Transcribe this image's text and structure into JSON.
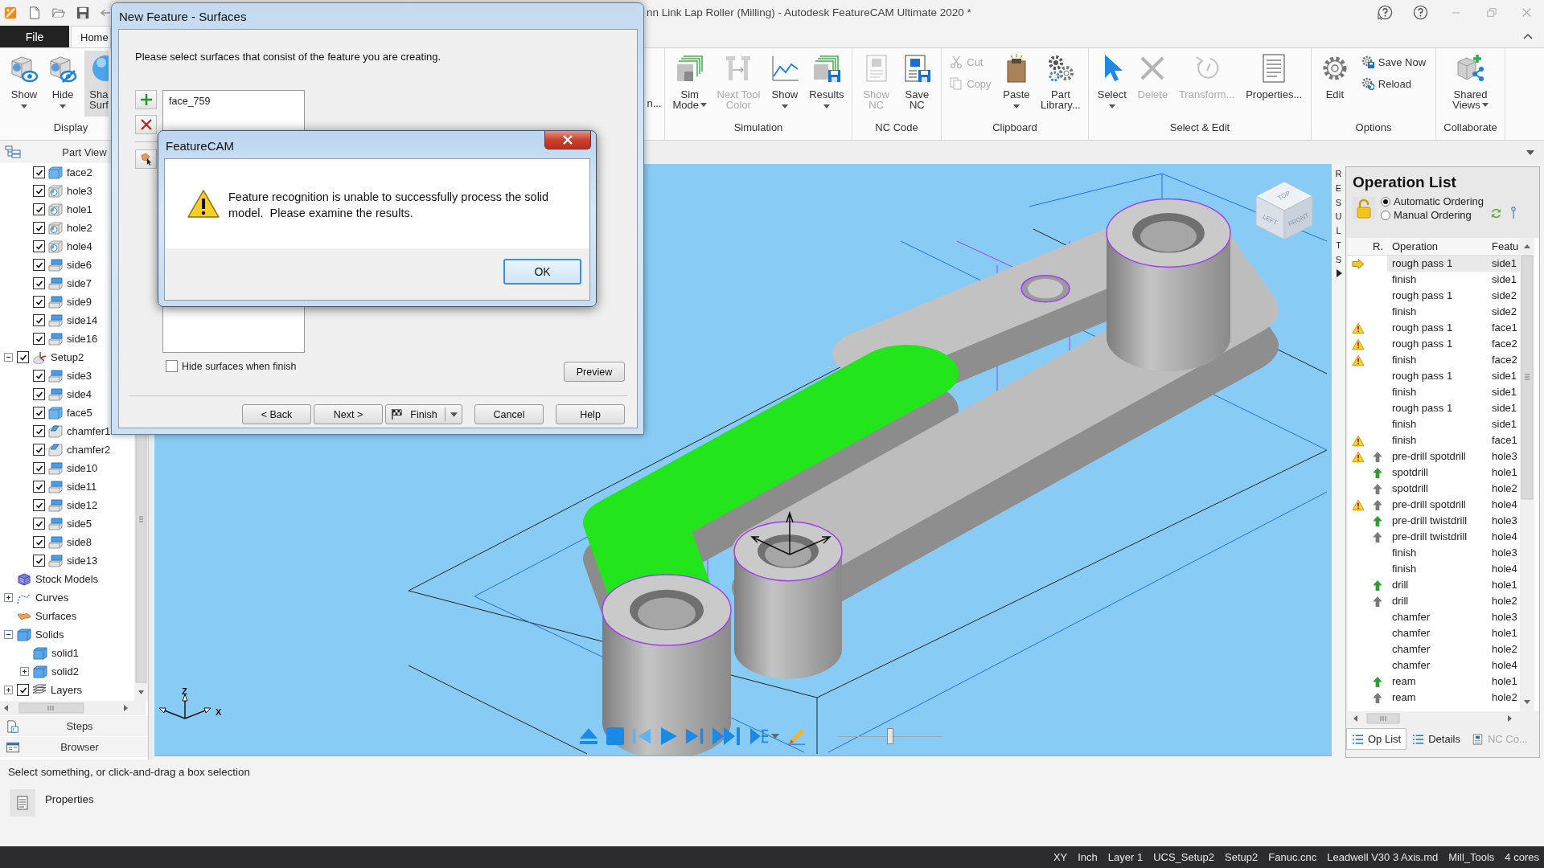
{
  "window": {
    "title": "nn Link Lap Roller (Milling) - Autodesk FeatureCAM Ultimate 2020 *"
  },
  "ribbon": {
    "tabs": [
      {
        "label": "File",
        "kind": "file",
        "selected": false
      },
      {
        "label": "Home",
        "kind": "tab",
        "selected": true
      }
    ],
    "groups": [
      {
        "label": "Display",
        "buttons": [
          {
            "kind": "show",
            "lines": [
              "Show"
            ],
            "menu": true,
            "disabled": false,
            "highlighted": false
          },
          {
            "kind": "hide",
            "lines": [
              "Hide"
            ],
            "menu": true,
            "disabled": false,
            "highlighted": false
          },
          {
            "kind": "shaded",
            "lines": [
              "Sha",
              "Surf"
            ],
            "menu": false,
            "disabled": false,
            "highlighted": true
          }
        ]
      },
      {
        "buttons": [
          {
            "kind": "partial",
            "lines": [
              "n..."
            ],
            "menu": false,
            "disabled": false,
            "highlighted": false
          }
        ]
      },
      {
        "label": "Simulation",
        "buttons": [
          {
            "kind": "sim-mode",
            "lines": [
              "Sim",
              "Mode"
            ],
            "menu": true,
            "disabled": false,
            "highlighted": false
          },
          {
            "kind": "next-tool",
            "lines": [
              "Next Tool",
              "Color"
            ],
            "menu": false,
            "disabled": true,
            "highlighted": false
          },
          {
            "kind": "chart",
            "lines": [
              "Show"
            ],
            "menu": true,
            "disabled": false,
            "highlighted": false
          },
          {
            "kind": "results",
            "lines": [
              "Results"
            ],
            "menu": true,
            "disabled": false,
            "highlighted": false
          }
        ]
      },
      {
        "label": "NC Code",
        "buttons": [
          {
            "kind": "show-nc",
            "lines": [
              "Show",
              "NC"
            ],
            "menu": false,
            "disabled": true,
            "highlighted": false
          },
          {
            "kind": "save-nc",
            "lines": [
              "Save",
              "NC"
            ],
            "menu": false,
            "disabled": false,
            "highlighted": false
          }
        ]
      },
      {
        "label": "Clipboard",
        "buttons": [
          {
            "kind": "stack",
            "items": [
              {
                "kind": "cut",
                "label": "Cut",
                "disabled": true
              },
              {
                "kind": "copy",
                "label": "Copy",
                "disabled": true
              }
            ]
          },
          {
            "kind": "paste",
            "lines": [
              "Paste"
            ],
            "menu": true,
            "disabled": false,
            "highlighted": false
          },
          {
            "kind": "library",
            "lines": [
              "Part",
              "Library..."
            ],
            "menu": false,
            "disabled": false,
            "highlighted": false
          }
        ]
      },
      {
        "label": "Select & Edit",
        "buttons": [
          {
            "kind": "select",
            "lines": [
              "Select"
            ],
            "menu": true,
            "disabled": false,
            "highlighted": false
          },
          {
            "kind": "delete",
            "lines": [
              "Delete"
            ],
            "menu": false,
            "disabled": true,
            "highlighted": false
          },
          {
            "kind": "transform",
            "lines": [
              "Transform..."
            ],
            "menu": false,
            "disabled": true,
            "highlighted": false
          },
          {
            "kind": "properties",
            "lines": [
              "Properties..."
            ],
            "menu": false,
            "disabled": false,
            "highlighted": false
          }
        ]
      },
      {
        "label": "Options",
        "buttons": [
          {
            "kind": "edit",
            "lines": [
              "Edit"
            ],
            "menu": false,
            "disabled": false,
            "highlighted": false
          },
          {
            "kind": "stack",
            "items": [
              {
                "kind": "save-now",
                "label": "Save Now",
                "disabled": false
              },
              {
                "kind": "reload",
                "label": "Reload",
                "disabled": false
              }
            ]
          }
        ]
      },
      {
        "label": "Collaborate",
        "buttons": [
          {
            "kind": "shared",
            "lines": [
              "Shared",
              "Views"
            ],
            "menu": true,
            "disabled": false,
            "highlighted": false
          }
        ]
      }
    ]
  },
  "part_view": {
    "title": "Part View",
    "tree_continued": [
      {
        "label": "face2",
        "kind": "face",
        "checked": true
      },
      {
        "label": "hole3",
        "kind": "hole",
        "checked": true
      },
      {
        "label": "hole1",
        "kind": "hole",
        "checked": true
      },
      {
        "label": "hole2",
        "kind": "hole",
        "checked": true
      },
      {
        "label": "hole4",
        "kind": "hole",
        "checked": true
      },
      {
        "label": "side6",
        "kind": "side",
        "checked": true
      },
      {
        "label": "side7",
        "kind": "side",
        "checked": true
      },
      {
        "label": "side9",
        "kind": "side",
        "checked": true
      },
      {
        "label": "side14",
        "kind": "side",
        "checked": true
      },
      {
        "label": "side16",
        "kind": "side",
        "checked": true
      }
    ],
    "tree": [
      {
        "label": "Setup2",
        "kind": "setup",
        "checked": true,
        "expanded": true,
        "children": [
          {
            "label": "side3",
            "kind": "side",
            "checked": true
          },
          {
            "label": "side4",
            "kind": "side",
            "checked": true
          },
          {
            "label": "face5",
            "kind": "face",
            "checked": true
          },
          {
            "label": "chamfer1",
            "kind": "chamfer",
            "checked": true
          },
          {
            "label": "chamfer2",
            "kind": "chamfer",
            "checked": true
          },
          {
            "label": "side10",
            "kind": "side",
            "checked": true
          },
          {
            "label": "side11",
            "kind": "side",
            "checked": true
          },
          {
            "label": "side12",
            "kind": "side",
            "checked": true
          },
          {
            "label": "side5",
            "kind": "side",
            "checked": true
          },
          {
            "label": "side8",
            "kind": "side",
            "checked": true
          },
          {
            "label": "side13",
            "kind": "side",
            "checked": true
          }
        ]
      },
      {
        "label": "Stock Models",
        "kind": "stock"
      },
      {
        "label": "Curves",
        "kind": "curves",
        "expanded": false
      },
      {
        "label": "Surfaces",
        "kind": "surfaces"
      },
      {
        "label": "Solids",
        "kind": "solids",
        "expanded": true,
        "children": [
          {
            "label": "solid1",
            "kind": "solid"
          },
          {
            "label": "solid2",
            "kind": "solid",
            "expanded": false
          }
        ]
      },
      {
        "label": "Layers",
        "kind": "layers",
        "checked": true,
        "expanded": false
      }
    ]
  },
  "panel_bars": [
    {
      "label": "Steps",
      "kind": "steps"
    },
    {
      "label": "Browser",
      "kind": "browser"
    }
  ],
  "viewport": {
    "view_cube": [
      "TOP",
      "LEFT",
      "FRONT"
    ],
    "axes": [
      "Z",
      "X"
    ],
    "playback": {
      "buttons": [
        {
          "kind": "eject",
          "disabled": false,
          "menu": false
        },
        {
          "kind": "stop",
          "disabled": false,
          "menu": false
        },
        {
          "kind": "step-back",
          "disabled": true,
          "menu": false
        },
        {
          "kind": "play",
          "disabled": false,
          "menu": false
        },
        {
          "kind": "step-forward",
          "disabled": false,
          "menu": false
        },
        {
          "kind": "fast-forward",
          "disabled": false,
          "menu": false
        },
        {
          "kind": "step-lines",
          "disabled": false,
          "menu": true
        },
        {
          "kind": "pencil",
          "disabled": false,
          "menu": false
        }
      ],
      "speed": {
        "level": 0.5
      }
    }
  },
  "results_tab": {
    "label": "RESULTS"
  },
  "operation_list": {
    "title": "Operation List",
    "ordering": [
      {
        "label": "Automatic Ordering",
        "selected": true
      },
      {
        "label": "Manual Ordering",
        "selected": false
      }
    ],
    "columns": [
      "R.",
      "Operation",
      "Featu"
    ],
    "rows": [
      {
        "current": true,
        "warning": false,
        "operation": "rough pass 1",
        "feature": "side1",
        "selected": true
      },
      {
        "current": false,
        "warning": false,
        "operation": "finish",
        "feature": "side1",
        "selected": false
      },
      {
        "current": false,
        "warning": false,
        "operation": "rough pass 1",
        "feature": "side2",
        "selected": false
      },
      {
        "current": false,
        "warning": false,
        "operation": "finish",
        "feature": "side2",
        "selected": false
      },
      {
        "current": false,
        "warning": true,
        "operation": "rough pass 1",
        "feature": "face1",
        "selected": false
      },
      {
        "current": false,
        "warning": true,
        "operation": "rough pass 1",
        "feature": "face2",
        "selected": false
      },
      {
        "current": false,
        "warning": true,
        "operation": "finish",
        "feature": "face2",
        "selected": false
      },
      {
        "current": false,
        "warning": false,
        "operation": "rough pass 1",
        "feature": "side1",
        "selected": false
      },
      {
        "current": false,
        "warning": false,
        "operation": "finish",
        "feature": "side1",
        "selected": false
      },
      {
        "current": false,
        "warning": false,
        "operation": "rough pass 1",
        "feature": "side1",
        "selected": false
      },
      {
        "current": false,
        "warning": false,
        "operation": "finish",
        "feature": "side1",
        "selected": false
      },
      {
        "current": false,
        "warning": true,
        "operation": "finish",
        "feature": "face1",
        "selected": false
      },
      {
        "current": false,
        "warning": true,
        "arrow": {
          "color": "#7a7a7a"
        },
        "operation": "pre-drill spotdrill",
        "feature": "hole3",
        "selected": false
      },
      {
        "current": false,
        "warning": false,
        "arrow": {
          "color": "#2e9e2e"
        },
        "operation": "spotdrill",
        "feature": "hole1",
        "selected": false
      },
      {
        "current": false,
        "warning": false,
        "arrow": {
          "color": "#7a7a7a"
        },
        "operation": "spotdrill",
        "feature": "hole2",
        "selected": false
      },
      {
        "current": false,
        "warning": true,
        "arrow": {
          "color": "#7a7a7a"
        },
        "operation": "pre-drill spotdrill",
        "feature": "hole4",
        "selected": false
      },
      {
        "current": false,
        "warning": false,
        "arrow": {
          "color": "#2e9e2e"
        },
        "operation": "pre-drill twistdrill",
        "feature": "hole3",
        "selected": false
      },
      {
        "current": false,
        "warning": false,
        "arrow": {
          "color": "#7a7a7a"
        },
        "operation": "pre-drill twistdrill",
        "feature": "hole4",
        "selected": false
      },
      {
        "current": false,
        "warning": false,
        "operation": "finish",
        "feature": "hole3",
        "selected": false
      },
      {
        "current": false,
        "warning": false,
        "operation": "finish",
        "feature": "hole4",
        "selected": false
      },
      {
        "current": false,
        "warning": false,
        "arrow": {
          "color": "#2e9e2e"
        },
        "operation": "drill",
        "feature": "hole1",
        "selected": false
      },
      {
        "current": false,
        "warning": false,
        "arrow": {
          "color": "#7a7a7a"
        },
        "operation": "drill",
        "feature": "hole2",
        "selected": false
      },
      {
        "current": false,
        "warning": false,
        "operation": "chamfer",
        "feature": "hole3",
        "selected": false
      },
      {
        "current": false,
        "warning": false,
        "operation": "chamfer",
        "feature": "hole1",
        "selected": false
      },
      {
        "current": false,
        "warning": false,
        "operation": "chamfer",
        "feature": "hole2",
        "selected": false
      },
      {
        "current": false,
        "warning": false,
        "operation": "chamfer",
        "feature": "hole4",
        "selected": false
      },
      {
        "current": false,
        "warning": false,
        "arrow": {
          "color": "#2e9e2e"
        },
        "operation": "ream",
        "feature": "hole1",
        "selected": false
      },
      {
        "current": false,
        "warning": false,
        "arrow": {
          "color": "#7a7a7a"
        },
        "operation": "ream",
        "feature": "hole2",
        "selected": false
      }
    ],
    "tabs": [
      {
        "label": "Op List",
        "kind": "list",
        "selected": true,
        "disabled": false
      },
      {
        "label": "Details",
        "kind": "list",
        "selected": false,
        "disabled": false
      },
      {
        "label": "NC Co...",
        "kind": "nc",
        "selected": false,
        "disabled": true
      }
    ]
  },
  "status_hint": "Select something, or click-and-drag a box selection",
  "properties_panel": {
    "label": "Properties"
  },
  "status_bar": [
    "XY",
    "Inch",
    "Layer 1",
    "UCS_Setup2",
    "Setup2",
    "Fanuc.cnc",
    "Leadwell V30 3 Axis.md",
    "Mill_Tools",
    "4 cores"
  ],
  "new_feature_dialog": {
    "title": "New Feature - Surfaces",
    "instruction": "Please select surfaces that consist of the feature you are creating.",
    "surfaces": [
      "face_759"
    ],
    "hide_surfaces": {
      "label": "Hide surfaces when finish",
      "checked": false
    },
    "preview": "Preview",
    "buttons": [
      {
        "label": "< Back",
        "kind": "plain"
      },
      {
        "label": "Next >",
        "kind": "plain"
      },
      {
        "label": "Finish",
        "kind": "split"
      },
      {
        "label": "Cancel",
        "kind": "plain"
      },
      {
        "label": "Help",
        "kind": "plain"
      }
    ]
  },
  "message_box": {
    "title": "FeatureCAM",
    "kind": "warning",
    "message": "Feature recognition is unable to successfully process the solid model.  Please examine the results.",
    "buttons": [
      {
        "label": "OK",
        "default": true
      }
    ]
  }
}
